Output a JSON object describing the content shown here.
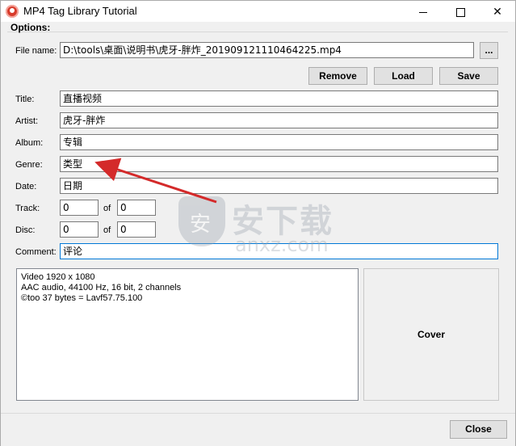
{
  "window": {
    "title": "MP4 Tag Library Tutorial",
    "controls": {
      "minimize": "",
      "maximize": "",
      "close": "✕"
    }
  },
  "options": {
    "group_label": "Options:",
    "file_name": {
      "label": "File name:",
      "value": "D:\\tools\\桌面\\说明书\\虎牙-胖炸_20190912111046422​5.mp4",
      "browse_label": "..."
    },
    "buttons": {
      "remove": "Remove",
      "load": "Load",
      "save": "Save"
    },
    "title": {
      "label": "Title:",
      "value": "直播视频"
    },
    "artist": {
      "label": "Artist:",
      "value": "虎牙-胖炸"
    },
    "album": {
      "label": "Album:",
      "value": "专辑"
    },
    "genre": {
      "label": "Genre:",
      "value": "类型"
    },
    "date": {
      "label": "Date:",
      "value": "日期"
    },
    "track": {
      "label": "Track:",
      "value": "0",
      "of_label": "of",
      "total": "0"
    },
    "disc": {
      "label": "Disc:",
      "value": "0",
      "of_label": "of",
      "total": "0"
    },
    "comment": {
      "label": "Comment:",
      "value": "评论"
    }
  },
  "info": {
    "lines": [
      "Video 1920 x 1080",
      "AAC audio, 44100 Hz, 16 bit, 2 channels",
      "©too 37 bytes = Lavf57.75.100"
    ]
  },
  "cover": {
    "label": "Cover"
  },
  "footer": {
    "close_label": "Close"
  },
  "watermark": {
    "text": "安下载",
    "url": "anxz.com"
  },
  "colors": {
    "annotation_arrow": "#d42a2a",
    "focus_border": "#0078d7",
    "app_icon": "#d83b2b"
  }
}
